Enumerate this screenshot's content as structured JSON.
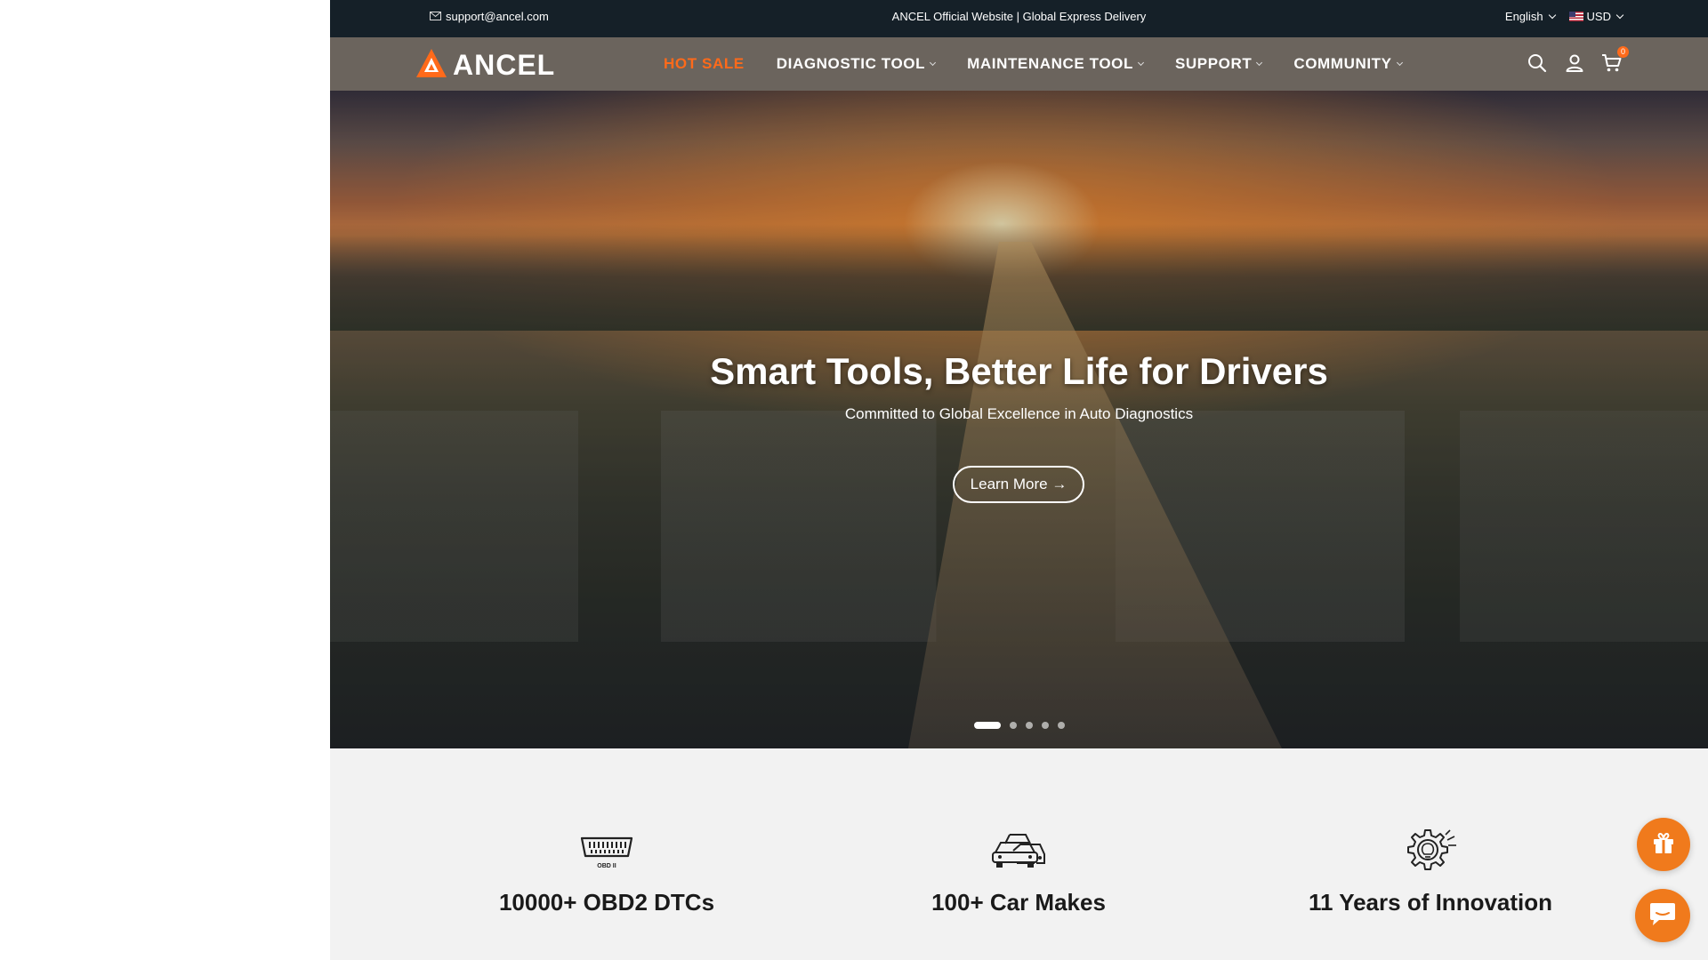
{
  "topbar": {
    "email": "support@ancel.com",
    "announcement": "ANCEL Official Website | Global Express Delivery",
    "language": "English",
    "currency": "USD"
  },
  "brand": {
    "name": "ANCEL",
    "accent_color": "#ff6a1a"
  },
  "nav": {
    "items": [
      {
        "label": "HOT SALE",
        "has_dropdown": false
      },
      {
        "label": "DIAGNOSTIC TOOL",
        "has_dropdown": true
      },
      {
        "label": "MAINTENANCE TOOL",
        "has_dropdown": true
      },
      {
        "label": "SUPPORT",
        "has_dropdown": true
      },
      {
        "label": "COMMUNITY",
        "has_dropdown": true
      }
    ],
    "cart_count": "0",
    "icons": [
      "search-icon",
      "account-icon",
      "cart-icon"
    ]
  },
  "hero": {
    "title": "Smart Tools, Better Life for Drivers",
    "subtitle": "Committed to Global Excellence in Auto Diagnostics",
    "button_label": "Learn More →",
    "slides_total": 5,
    "active_slide": 1
  },
  "stats": [
    {
      "label": "10000+ OBD2 DTCs",
      "icon": "obd2-connector-icon",
      "icon_caption": "OBD II"
    },
    {
      "label": "100+ Car Makes",
      "icon": "cars-icon"
    },
    {
      "label": "11 Years of Innovation",
      "icon": "gear-lightbulb-icon"
    }
  ],
  "floating": {
    "gift": "gift-icon",
    "chat": "chat-icon"
  }
}
